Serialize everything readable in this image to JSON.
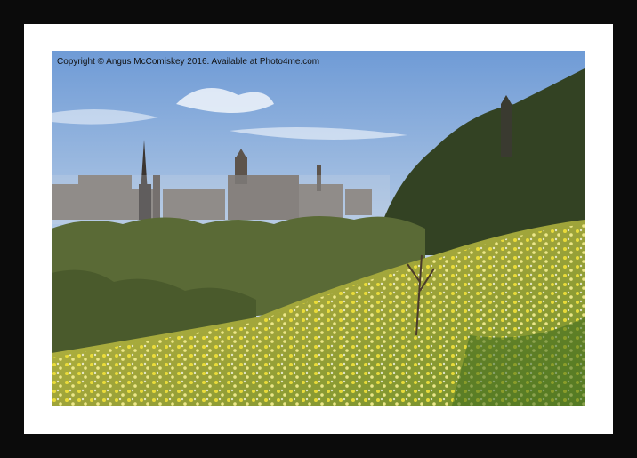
{
  "watermark": {
    "text": "Copyright  © Angus McComiskey  2016. Available at Photo4me.com"
  },
  "colors": {
    "frame": "#0b0b0b",
    "mount": "#ffffff",
    "sky_top": "#7fa6d9",
    "sky_bottom": "#dbe6f1",
    "grass_yellow": "#e7d84a",
    "grass_green": "#4f7d24",
    "trees_dark": "#2f3a1e"
  }
}
